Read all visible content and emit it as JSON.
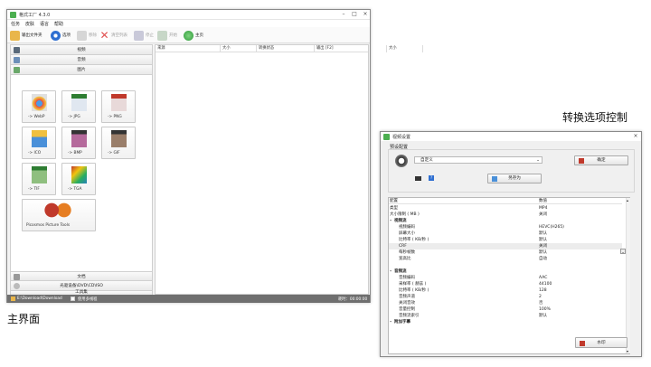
{
  "labels": {
    "main_interface": "主界面",
    "conversion_options": "转换选项控制"
  },
  "main_window": {
    "title": "格式工厂 4.3.0",
    "menu": [
      "任务",
      "皮肤",
      "语言",
      "帮助"
    ],
    "toolbar": [
      {
        "label": "输出文件夹",
        "enabled": true,
        "icon": "folder-icon"
      },
      {
        "label": "选项",
        "enabled": true,
        "icon": "options-icon"
      },
      {
        "label": "移除",
        "enabled": false,
        "icon": "remove-icon"
      },
      {
        "label": "清空列表",
        "enabled": false,
        "icon": "clear-list-icon"
      },
      {
        "label": "停止",
        "enabled": false,
        "icon": "stop-icon"
      },
      {
        "label": "开始",
        "enabled": false,
        "icon": "start-icon"
      },
      {
        "label": "主页",
        "enabled": true,
        "icon": "home-icon"
      }
    ],
    "categories_top": [
      "视频",
      "音频",
      "图片"
    ],
    "formats": [
      "-> WebP",
      "-> JPG",
      "-> PNG",
      "-> ICO",
      "-> BMP",
      "-> GIF",
      "-> TIF",
      "-> TGA"
    ],
    "picosmos_label": "Picosmos Picture Tools",
    "categories_bottom": [
      "文档",
      "光驱设备\\DVD\\CD\\ISO",
      "工具集"
    ],
    "columns": [
      "来源",
      "大小",
      "转换状态",
      "输出 [F2]",
      "大小"
    ],
    "status": {
      "path": "E:\\Download\\Download",
      "checkbox_label": "使用多线程",
      "elapsed": "耗时：00:00:00"
    }
  },
  "options_window": {
    "title": "视频设置",
    "group_label": "预设配置",
    "preset_value": "自定义",
    "ok_label": "确定",
    "save_as_label": "另存为",
    "prop_header": {
      "key": "配置",
      "value": "数值"
    },
    "rows": [
      {
        "k": "类型",
        "v": "MP4",
        "indent": 0
      },
      {
        "k": "大小限制 ( MB )",
        "v": "关闭",
        "indent": 0
      },
      {
        "k": "视频流",
        "v": "",
        "indent": 1,
        "header": true
      },
      {
        "k": "视频编码",
        "v": "HEVC(H265)",
        "indent": 2
      },
      {
        "k": "屏幕大小",
        "v": "默认",
        "indent": 2
      },
      {
        "k": "比特率 ( KB/秒 )",
        "v": "默认",
        "indent": 2
      },
      {
        "k": "CRF",
        "v": "关闭",
        "indent": 2,
        "selected": true
      },
      {
        "k": "每秒帧数",
        "v": "默认",
        "indent": 2
      },
      {
        "k": "宽高比",
        "v": "自动",
        "indent": 2
      },
      {
        "k": "",
        "v": "",
        "indent": 2,
        "faded": true
      },
      {
        "k": "音频流",
        "v": "",
        "indent": 1,
        "header": true
      },
      {
        "k": "音频编码",
        "v": "AAC",
        "indent": 2
      },
      {
        "k": "采样率 ( 赫兹 )",
        "v": "44100",
        "indent": 2
      },
      {
        "k": "比特率 ( KB/秒 )",
        "v": "128",
        "indent": 2
      },
      {
        "k": "音频声道",
        "v": "2",
        "indent": 2
      },
      {
        "k": "关闭音效",
        "v": "否",
        "indent": 2
      },
      {
        "k": "音量控制",
        "v": "100%",
        "indent": 2
      },
      {
        "k": "音频流索引",
        "v": "默认",
        "indent": 2
      },
      {
        "k": "附加字幕",
        "v": "",
        "indent": 1,
        "header": true
      }
    ],
    "watermark_label": "水印"
  }
}
